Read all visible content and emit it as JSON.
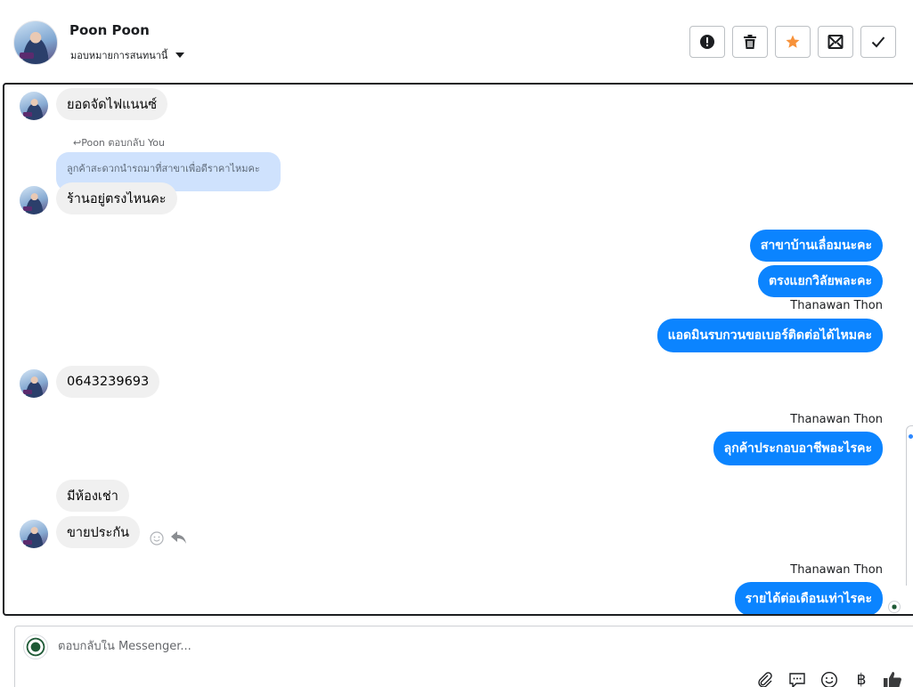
{
  "header": {
    "contact_name": "Poon Poon",
    "assign_label": "มอบหมายการสนทนานี้",
    "actions": [
      {
        "name": "spam-button",
        "icon": "alert-circle-icon"
      },
      {
        "name": "delete-button",
        "icon": "trash-icon"
      },
      {
        "name": "star-button",
        "icon": "star-icon"
      },
      {
        "name": "mark-unread-button",
        "icon": "envelope-icon"
      },
      {
        "name": "done-button",
        "icon": "check-icon"
      }
    ],
    "star_color": "#f7923a"
  },
  "messages": {
    "m1": "ยอดจัดไฟแนนซ์",
    "reply_note": "↩Poon ตอบกลับ You",
    "reply_quote": "ลูกค้าสะดวกนำรถมาที่สาขาเพื่อดีราคาไหมคะ",
    "m2": "ร้านอยู่ตรงไหนคะ",
    "o1": "สาขาบ้านเลื่อมนะคะ",
    "o2": "ตรงแยกวิลัยพละคะ",
    "sender1": "Thanawan Thon",
    "o3": "แอดมินรบกวนขอเบอร์ติดต่อได้ไหมคะ",
    "m3": "0643239693",
    "sender2": "Thanawan Thon",
    "o4": "ลุกค้าประกอบอาชีพอะไรคะ",
    "m4": "มีห้องเช่า",
    "m5": "ขายประกัน",
    "sender3": "Thanawan Thon",
    "o5": "รายได้ต่อเดือนเท่าไรคะ"
  },
  "composer": {
    "placeholder": "ตอบกลับใน Messenger...",
    "tools": [
      "paperclip-icon",
      "chat-bubble-icon",
      "smiley-icon",
      "baht-icon",
      "thumbs-up-icon"
    ],
    "baht_symbol": "฿"
  },
  "colors": {
    "outgoing_bubble": "#0b84ff",
    "incoming_bubble": "#f0f0f0",
    "quoted_bubble": "#cfe2fd",
    "thumbs_up": "#3a3b3c"
  }
}
